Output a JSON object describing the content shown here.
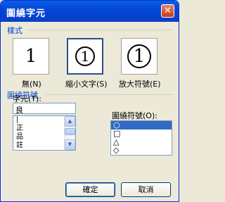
{
  "window": {
    "title": "圍繞字元",
    "close_glyph": "✕"
  },
  "style_group": {
    "label": "樣式",
    "options": [
      {
        "glyph": "1",
        "caption": "無(N)",
        "selected": false
      },
      {
        "glyph": "1",
        "caption": "縮小文字(S)",
        "selected": true
      },
      {
        "glyph": "1",
        "caption": "放大符號(E)",
        "selected": false
      }
    ]
  },
  "enclosure_group": {
    "label": "圍繞符號",
    "text_label": "字元(T):",
    "text_value": "良",
    "text_items": [
      "|",
      "正",
      "品",
      "註"
    ],
    "symbol_label": "圍繞符號(O):",
    "symbols": [
      "○",
      "□",
      "△",
      "◇"
    ]
  },
  "buttons": {
    "ok": "確定",
    "cancel": "取消"
  }
}
